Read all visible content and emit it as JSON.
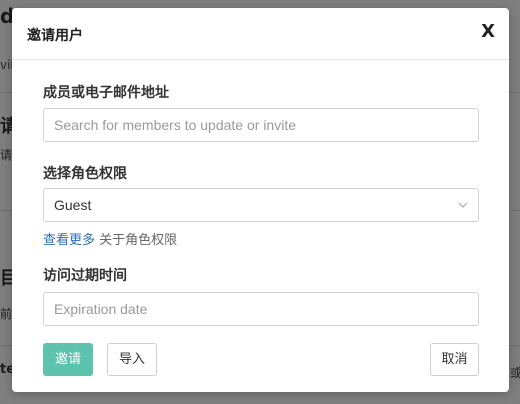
{
  "background": {
    "fragments": [
      "de",
      "vik",
      "请",
      "请",
      "目",
      "前",
      "te",
      "或"
    ]
  },
  "dialog": {
    "title": "邀请用户",
    "close_label": "X",
    "members": {
      "label": "成员或电子邮件地址",
      "placeholder": "Search for members to update or invite",
      "value": ""
    },
    "role": {
      "label": "选择角色权限",
      "selected": "Guest",
      "hint_link": "查看更多",
      "hint_text": " 关于角色权限"
    },
    "expiration": {
      "label": "访问过期时间",
      "placeholder": "Expiration date",
      "value": ""
    },
    "buttons": {
      "invite": "邀请",
      "import": "导入",
      "cancel": "取消"
    }
  },
  "colors": {
    "primary": "#5dc3ad",
    "link": "#2a6fb6",
    "overlay": "#7f7f7f"
  }
}
